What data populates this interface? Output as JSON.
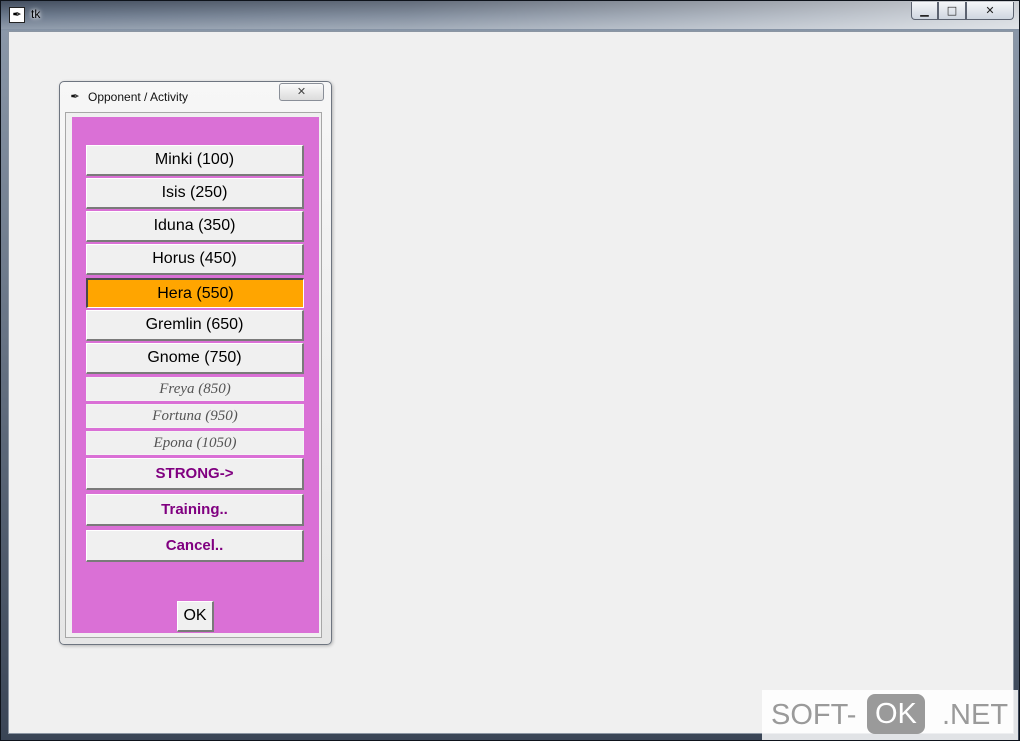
{
  "window": {
    "title": "tk",
    "icon": "feather-tk-icon",
    "controls": {
      "minimize": "▁",
      "maximize": "□",
      "close": "✕"
    }
  },
  "dialog": {
    "title": "Opponent / Activity",
    "icon": "feather-tk-icon",
    "close_glyph": "✕",
    "panel_color": "#da70d6",
    "selected_color": "#ffa500",
    "action_text_color": "#800080",
    "opponents": [
      {
        "label": "Minki (100)",
        "state": "normal"
      },
      {
        "label": "Isis (250)",
        "state": "normal"
      },
      {
        "label": "Iduna (350)",
        "state": "normal"
      },
      {
        "label": "Horus (450)",
        "state": "normal"
      },
      {
        "label": "Hera (550)",
        "state": "selected"
      },
      {
        "label": "Gremlin (650)",
        "state": "normal"
      },
      {
        "label": "Gnome (750)",
        "state": "normal"
      },
      {
        "label": "Freya (850)",
        "state": "locked"
      },
      {
        "label": "Fortuna (950)",
        "state": "locked"
      },
      {
        "label": "Epona (1050)",
        "state": "locked"
      }
    ],
    "actions": {
      "strong": "STRONG->",
      "training": "Training..",
      "cancel": "Cancel.."
    },
    "ok_label": "OK"
  },
  "watermark": {
    "part1": "SOFT-",
    "part2": "OK",
    "part3": ".NET"
  }
}
